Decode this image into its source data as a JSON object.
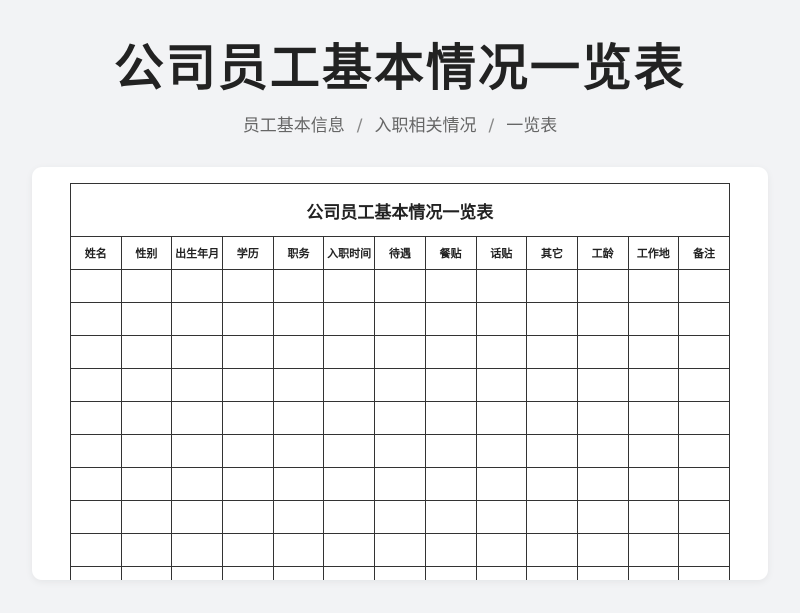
{
  "header": {
    "title": "公司员工基本情况一览表",
    "breadcrumb": [
      "员工基本信息",
      "入职相关情况",
      "一览表"
    ],
    "separator": "/"
  },
  "sheet": {
    "title": "公司员工基本情况一览表",
    "columns": [
      "姓名",
      "性别",
      "出生年月",
      "学历",
      "职务",
      "入职时间",
      "待遇",
      "餐贴",
      "话贴",
      "其它",
      "工龄",
      "工作地",
      "备注"
    ],
    "visible_empty_rows": 10
  },
  "colors": {
    "background": "#f2f3f5",
    "card": "#ffffff",
    "grid_line": "#333333",
    "title_text": "#222222",
    "subtitle_text": "#666666"
  }
}
